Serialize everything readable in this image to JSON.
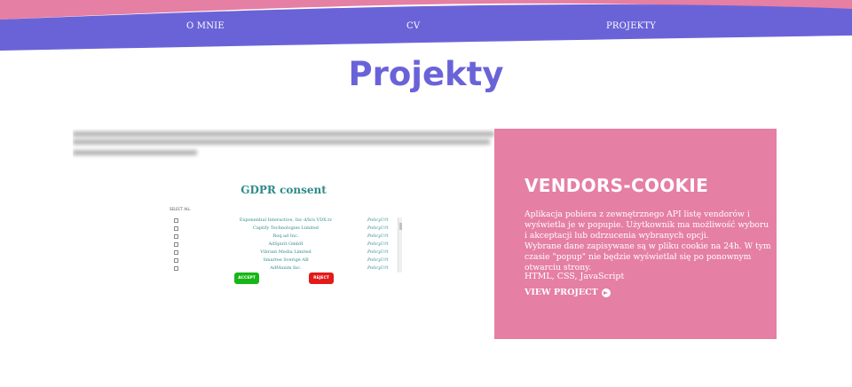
{
  "nav": {
    "items": [
      {
        "label": "O MNIE"
      },
      {
        "label": "CV"
      },
      {
        "label": "PROJEKTY"
      }
    ]
  },
  "page": {
    "title": "Projekty"
  },
  "preview": {
    "gdpr_title": "GDPR consent",
    "select_all": "SELECT ALL",
    "vendors": [
      {
        "name": "Exponential Interactive, Inc d/b/a VDX.tv",
        "policy": "PolicyUrl"
      },
      {
        "name": "Captify Technologies Limited",
        "policy": "PolicyUrl"
      },
      {
        "name": "Roq.ad Inc.",
        "policy": "PolicyUrl"
      },
      {
        "name": "AdSpirit GmbH",
        "policy": "PolicyUrl"
      },
      {
        "name": "Vibrant Media Limited",
        "policy": "PolicyUrl"
      },
      {
        "name": "Smartee Sverige AB",
        "policy": "PolicyUrl"
      },
      {
        "name": "AdMaxim Inc.",
        "policy": "PolicyUrl"
      }
    ],
    "accept_label": "ACCEPT",
    "reject_label": "REJECT"
  },
  "project": {
    "title": "VENDORS-COOKIE",
    "description_1": "Aplikacja pobiera z zewnętrznego API listę vendorów i wyświetla je w popupie. Użytkownik ma możliwość wyboru i akceptacji lub odrzucenia wybranych opcji.",
    "description_2": "Wybrane dane zapisywane są w pliku cookie na 24h. W tym czasie \"popup\" nie będzie wyświetlał się po ponownym otwarciu strony.",
    "tech": "HTML, CSS, JavaScript",
    "link_label": "VIEW PROJECT"
  },
  "colors": {
    "purple": "#6a63d8",
    "pink": "#e57fa4",
    "teal": "#2e8a8a",
    "accept_green": "#17b617",
    "reject_red": "#e21a1a"
  },
  "icons": {
    "view_project": "arrow-circle-right-icon"
  }
}
